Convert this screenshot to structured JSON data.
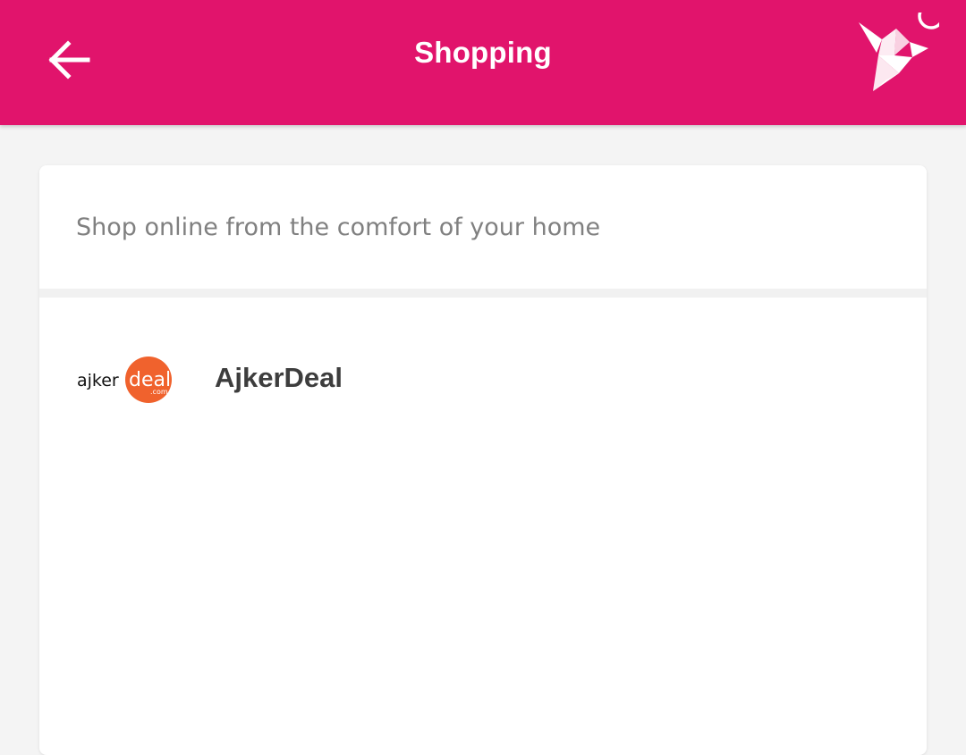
{
  "header": {
    "title": "Shopping",
    "back_icon": "arrow-left-icon",
    "logo_icon": "origami-bird-logo",
    "background": "#e1146c"
  },
  "card": {
    "description": "Shop online from the comfort of your home"
  },
  "merchants": [
    {
      "name": "AjkerDeal",
      "logo": {
        "prefix": "ajker",
        "badge": "deal",
        "suffix": ".com",
        "badge_color": "#f0622d"
      }
    }
  ]
}
